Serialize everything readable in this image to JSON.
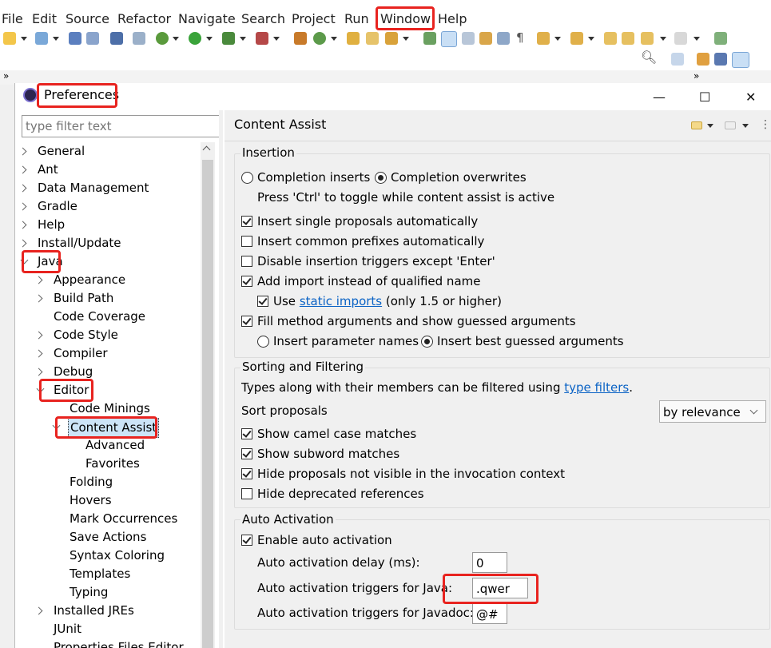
{
  "menubar": {
    "items": [
      "File",
      "Edit",
      "Source",
      "Refactor",
      "Navigate",
      "Search",
      "Project",
      "Run",
      "Window",
      "Help"
    ]
  },
  "dialog": {
    "title": "Preferences",
    "filter_placeholder": "type filter text",
    "controls": {
      "minimize": "—",
      "maximize": "☐",
      "close": "✕"
    }
  },
  "tree": [
    {
      "label": "General",
      "level": 0,
      "state": "collapsed"
    },
    {
      "label": "Ant",
      "level": 0,
      "state": "collapsed"
    },
    {
      "label": "Data Management",
      "level": 0,
      "state": "collapsed"
    },
    {
      "label": "Gradle",
      "level": 0,
      "state": "collapsed"
    },
    {
      "label": "Help",
      "level": 0,
      "state": "collapsed"
    },
    {
      "label": "Install/Update",
      "level": 0,
      "state": "collapsed"
    },
    {
      "label": "Java",
      "level": 0,
      "state": "expanded"
    },
    {
      "label": "Appearance",
      "level": 1,
      "state": "collapsed"
    },
    {
      "label": "Build Path",
      "level": 1,
      "state": "collapsed"
    },
    {
      "label": "Code Coverage",
      "level": 1,
      "state": "leaf"
    },
    {
      "label": "Code Style",
      "level": 1,
      "state": "collapsed"
    },
    {
      "label": "Compiler",
      "level": 1,
      "state": "collapsed"
    },
    {
      "label": "Debug",
      "level": 1,
      "state": "collapsed"
    },
    {
      "label": "Editor",
      "level": 1,
      "state": "expanded"
    },
    {
      "label": "Code Minings",
      "level": 2,
      "state": "leaf"
    },
    {
      "label": "Content Assist",
      "level": 2,
      "state": "expanded",
      "selected": true
    },
    {
      "label": "Advanced",
      "level": 3,
      "state": "leaf"
    },
    {
      "label": "Favorites",
      "level": 3,
      "state": "leaf"
    },
    {
      "label": "Folding",
      "level": 2,
      "state": "leaf"
    },
    {
      "label": "Hovers",
      "level": 2,
      "state": "leaf"
    },
    {
      "label": "Mark Occurrences",
      "level": 2,
      "state": "leaf"
    },
    {
      "label": "Save Actions",
      "level": 2,
      "state": "leaf"
    },
    {
      "label": "Syntax Coloring",
      "level": 2,
      "state": "leaf"
    },
    {
      "label": "Templates",
      "level": 2,
      "state": "leaf"
    },
    {
      "label": "Typing",
      "level": 2,
      "state": "leaf"
    },
    {
      "label": "Installed JREs",
      "level": 1,
      "state": "collapsed"
    },
    {
      "label": "JUnit",
      "level": 1,
      "state": "leaf"
    },
    {
      "label": "Properties Files Editor",
      "level": 1,
      "state": "leaf"
    }
  ],
  "page": {
    "title": "Content Assist",
    "insertion": {
      "title": "Insertion",
      "radio_completion_inserts": "Completion inserts",
      "radio_completion_overwrites": "Completion overwrites",
      "toggle_hint": "Press 'Ctrl' to toggle while content assist is active",
      "insert_single": "Insert single proposals automatically",
      "insert_common": "Insert common prefixes automatically",
      "disable_triggers": "Disable insertion triggers except 'Enter'",
      "add_import": "Add import instead of qualified name",
      "use_prefix": "Use",
      "static_imports": "static imports",
      "use_suffix": "(only 1.5 or higher)",
      "fill_args": "Fill method arguments and show guessed arguments",
      "radio_param_names": "Insert parameter names",
      "radio_best_guessed": "Insert best guessed arguments"
    },
    "sorting": {
      "title": "Sorting and Filtering",
      "types_text": "Types along with their members can be filtered using",
      "type_filters": "type filters",
      "types_period": ".",
      "sort_label": "Sort proposals",
      "sort_value": "by relevance",
      "camel": "Show camel case matches",
      "subword": "Show subword matches",
      "hide_not_visible": "Hide proposals not visible in the invocation context",
      "hide_deprecated": "Hide deprecated references"
    },
    "auto": {
      "title": "Auto Activation",
      "enable": "Enable auto activation",
      "delay_label": "Auto activation delay (ms):",
      "delay_value": "0",
      "java_label": "Auto activation triggers for Java:",
      "java_value": ".qwer",
      "javadoc_label": "Auto activation triggers for Javadoc:",
      "javadoc_value": "@#"
    }
  },
  "colors": {
    "highlight": "#e8231f",
    "selection": "#cce4f7",
    "link": "#0b63c5"
  }
}
